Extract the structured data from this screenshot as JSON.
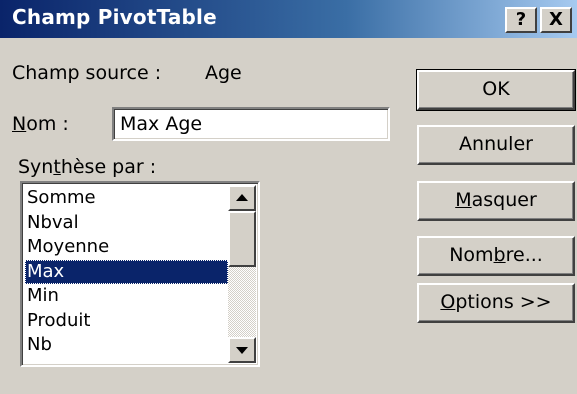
{
  "window": {
    "title": "Champ PivotTable",
    "help_label": "?",
    "close_label": "X"
  },
  "source": {
    "label": "Champ source :",
    "value": "Age"
  },
  "name": {
    "label_ul": "N",
    "label_rest": "om :",
    "value": "Max Age"
  },
  "summary": {
    "label_pre": "Syn",
    "label_ul": "t",
    "label_post": "hèse par :",
    "items": [
      "Somme",
      "Nbval",
      "Moyenne",
      "Max",
      "Min",
      "Produit",
      "Nb"
    ],
    "selected": "Max"
  },
  "buttons": {
    "ok": "OK",
    "cancel": "Annuler",
    "hide_ul": "M",
    "hide_rest": "asquer",
    "number_pre": "Nom",
    "number_ul": "b",
    "number_post": "re...",
    "options_ul": "O",
    "options_rest": "ptions >>"
  },
  "colors": {
    "titlebar_start": "#0a246a",
    "titlebar_end": "#a6caf0",
    "selection": "#0a246a",
    "face": "#d4d0c8"
  }
}
